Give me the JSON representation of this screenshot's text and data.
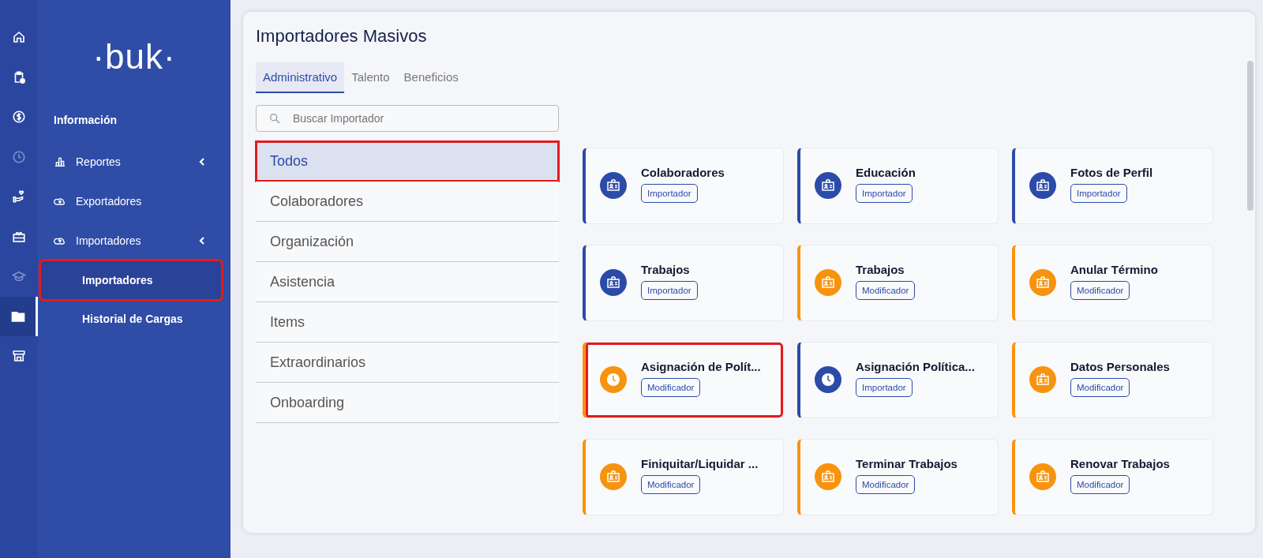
{
  "rail": [
    {
      "selected": false,
      "disabled": false
    },
    {
      "selected": false,
      "disabled": false
    },
    {
      "selected": false,
      "disabled": false
    },
    {
      "selected": false,
      "disabled": true
    },
    {
      "selected": false,
      "disabled": false
    },
    {
      "selected": false,
      "disabled": false
    },
    {
      "selected": false,
      "disabled": true
    },
    {
      "selected": true,
      "disabled": false
    },
    {
      "selected": false,
      "disabled": false
    }
  ],
  "sidebar": {
    "logo": "·buk·",
    "section": "Información",
    "items": [
      {
        "label": "Reportes",
        "expandable": true
      },
      {
        "label": "Exportadores",
        "expandable": false
      },
      {
        "label": "Importadores",
        "expandable": true,
        "children": [
          {
            "label": "Importadores",
            "selected": true,
            "highlighted": true
          },
          {
            "label": "Historial de Cargas",
            "selected": false,
            "highlighted": false
          }
        ]
      }
    ]
  },
  "page": {
    "title": "Importadores Masivos",
    "tabs": [
      {
        "label": "Administrativo",
        "selected": true
      },
      {
        "label": "Talento",
        "selected": false
      },
      {
        "label": "Beneficios",
        "selected": false
      }
    ],
    "search": {
      "placeholder": "Buscar Importador"
    },
    "categories": [
      {
        "label": "Todos",
        "selected": true,
        "highlighted": true
      },
      {
        "label": "Colaboradores",
        "selected": false,
        "highlighted": false
      },
      {
        "label": "Organización",
        "selected": false,
        "highlighted": false
      },
      {
        "label": "Asistencia",
        "selected": false,
        "highlighted": false
      },
      {
        "label": "Items",
        "selected": false,
        "highlighted": false
      },
      {
        "label": "Extraordinarios",
        "selected": false,
        "highlighted": false
      },
      {
        "label": "Onboarding",
        "selected": false,
        "highlighted": false
      }
    ],
    "cards": [
      {
        "title": "Colaboradores",
        "badge": "Importador",
        "kind": "id-card",
        "color": "#2c4ba8",
        "highlighted": false
      },
      {
        "title": "Educación",
        "badge": "Importador",
        "kind": "id-card",
        "color": "#2c4ba8",
        "highlighted": false
      },
      {
        "title": "Fotos de Perfil",
        "badge": "Importador",
        "kind": "id-card",
        "color": "#2c4ba8",
        "highlighted": false
      },
      {
        "title": "Trabajos",
        "badge": "Importador",
        "kind": "id-card",
        "color": "#2c4ba8",
        "highlighted": false
      },
      {
        "title": "Trabajos",
        "badge": "Modificador",
        "kind": "id-card",
        "color": "#f7930e",
        "highlighted": false
      },
      {
        "title": "Anular Término",
        "badge": "Modificador",
        "kind": "id-card",
        "color": "#f7930e",
        "highlighted": false
      },
      {
        "title": "Asignación de Polít...",
        "badge": "Modificador",
        "kind": "clock",
        "color": "#f7930e",
        "highlighted": true
      },
      {
        "title": "Asignación Política...",
        "badge": "Importador",
        "kind": "clock",
        "color": "#2c4ba8",
        "highlighted": false
      },
      {
        "title": "Datos Personales",
        "badge": "Modificador",
        "kind": "id-card",
        "color": "#f7930e",
        "highlighted": false
      },
      {
        "title": "Finiquitar/Liquidar ...",
        "badge": "Modificador",
        "kind": "id-card",
        "color": "#f7930e",
        "highlighted": false
      },
      {
        "title": "Terminar Trabajos",
        "badge": "Modificador",
        "kind": "id-card",
        "color": "#f7930e",
        "highlighted": false
      },
      {
        "title": "Renovar Trabajos",
        "badge": "Modificador",
        "kind": "id-card",
        "color": "#f7930e",
        "highlighted": false
      }
    ]
  }
}
